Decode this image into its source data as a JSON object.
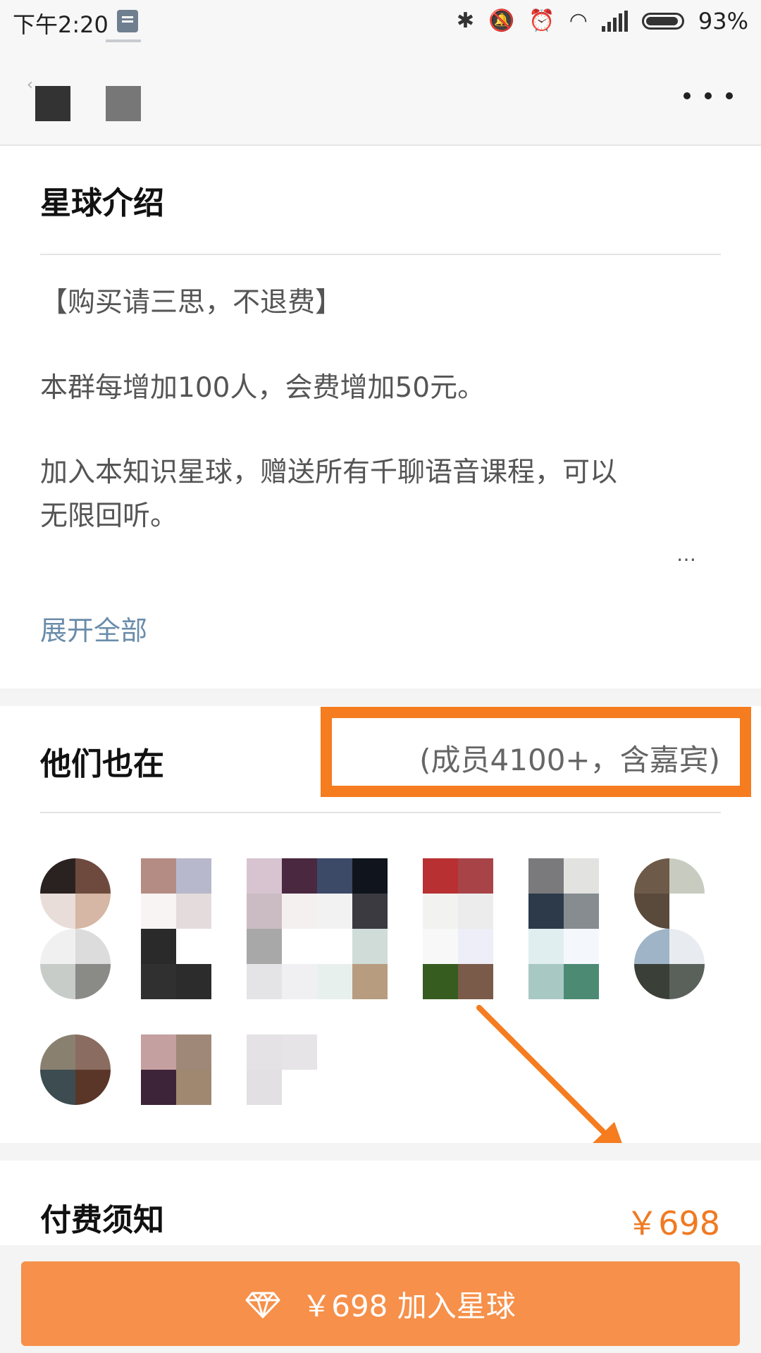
{
  "status_bar": {
    "time": "下午2:20",
    "battery": "93%",
    "battery_level": 0.93
  },
  "intro": {
    "heading": "星球介绍",
    "lines": [
      "【购买请三思，不退费】",
      "本群每增加100人，会费增加50元。",
      "加入本知识星球，赠送所有千聊语音课程，可以",
      "无限回听。"
    ],
    "ellipsis": "…",
    "expand_label": "展开全部"
  },
  "members": {
    "heading": "他们也在",
    "count_text": "(成员4100+，含嘉宾)"
  },
  "payment": {
    "heading": "付费须知",
    "price": "￥698"
  },
  "join_button": {
    "label": "￥698 加入星球"
  },
  "colors": {
    "accent_orange": "#f57c1f",
    "button_orange": "#f6904a",
    "price_orange": "#f07a22",
    "link_blue": "#6a8caa"
  },
  "icons": [
    "bluetooth-icon",
    "mute-icon",
    "alarm-icon",
    "wifi-icon",
    "signal-icon",
    "battery-icon",
    "more-icon",
    "diamond-icon",
    "arrow-icon"
  ]
}
